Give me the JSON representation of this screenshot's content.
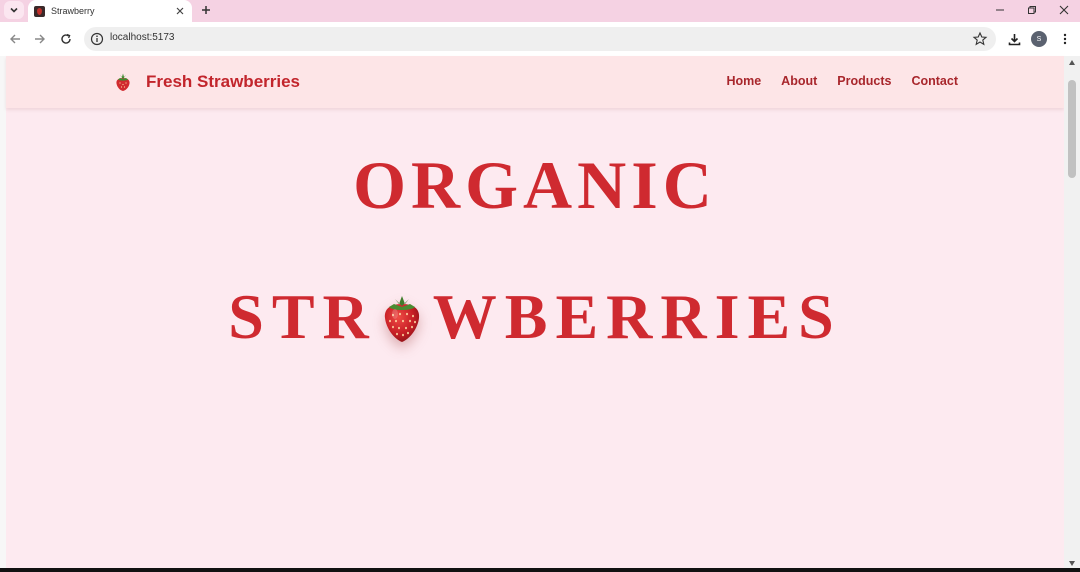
{
  "browser": {
    "tab_title": "Strawberry",
    "url": "localhost:5173",
    "profile_initial": "S"
  },
  "site": {
    "brand": "Fresh Strawberries",
    "nav": [
      "Home",
      "About",
      "Products",
      "Contact"
    ],
    "hero_line1": "ORGANIC",
    "hero_line2_before": "STR",
    "hero_line2_after": "WBERRIES"
  },
  "colors": {
    "accent": "#cf2a30",
    "page_bg": "#fdeaf0",
    "header_bg": "#fde5e7",
    "tabstrip_bg": "#f5d2e3"
  }
}
